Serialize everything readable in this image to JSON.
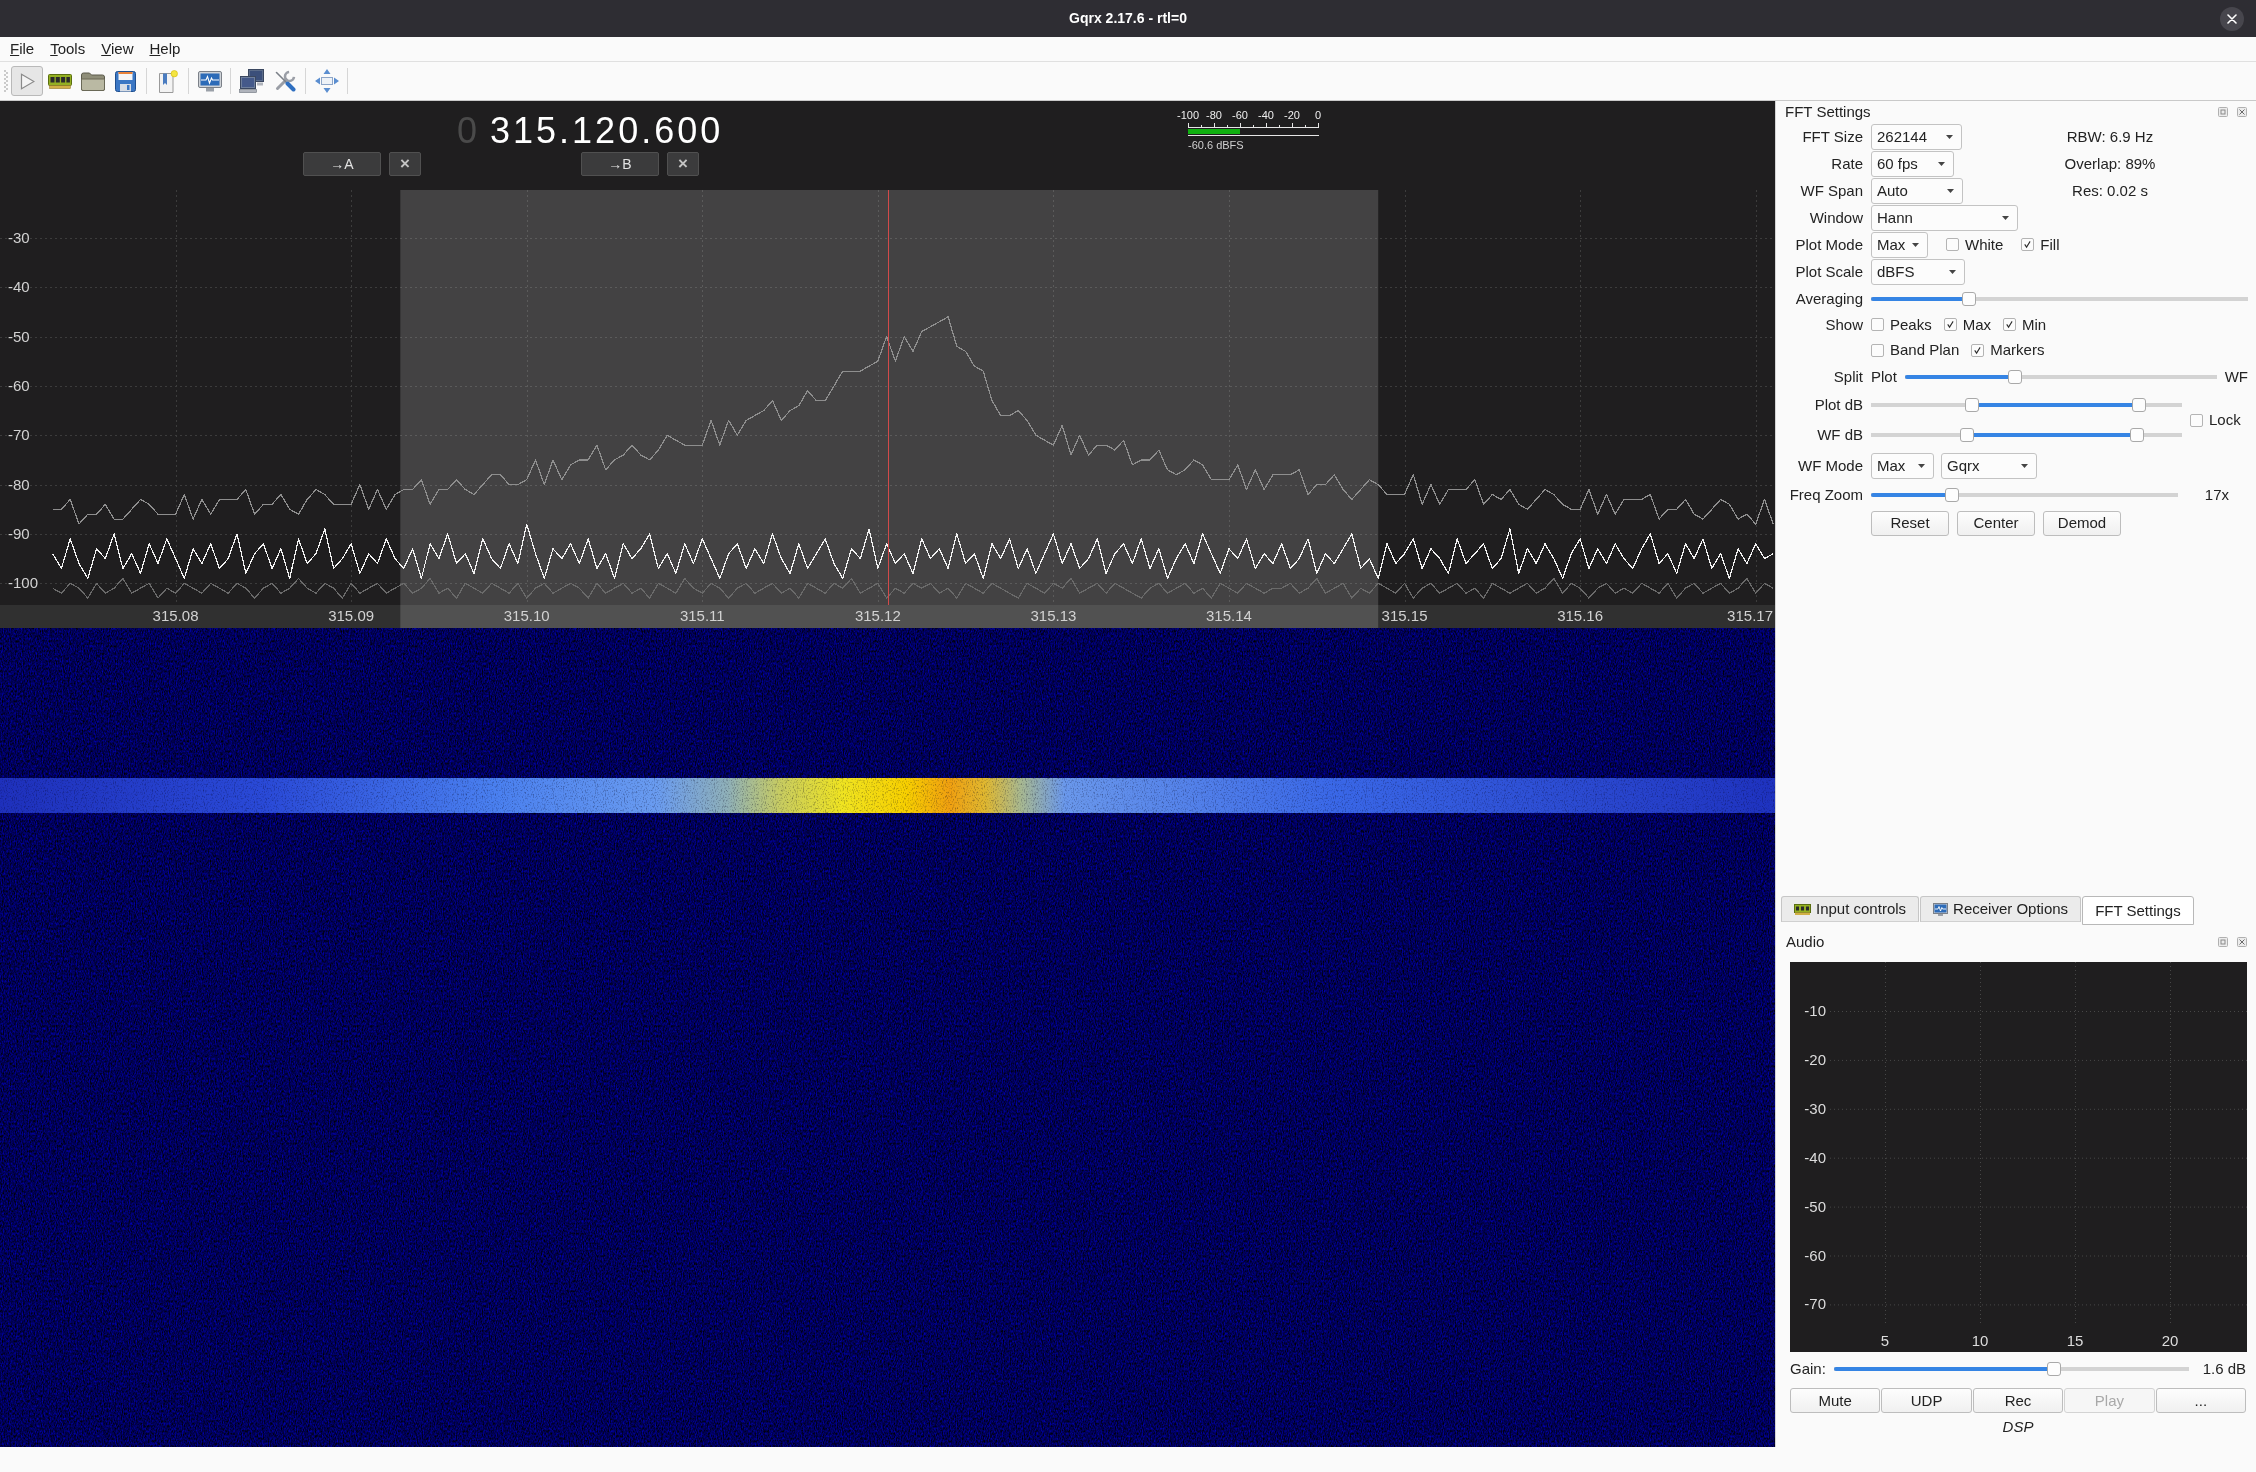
{
  "window": {
    "title": "Gqrx 2.17.6 - rtl=0"
  },
  "menu": [
    "File",
    "Tools",
    "View",
    "Help"
  ],
  "toolbar": {
    "start_pressed": true
  },
  "frequency": {
    "inactive_digits": "0",
    "digits": "315.120.600"
  },
  "markers": [
    {
      "set": "→A",
      "clear": "×"
    },
    {
      "set": "→B",
      "clear": "×"
    }
  ],
  "meter": {
    "ticks": [
      "-100",
      "-80",
      "-60",
      "-40",
      "-20",
      "0"
    ],
    "level": 0.394,
    "reading": "-60.6 dBFS"
  },
  "spectrum": {
    "chart_data": {
      "type": "line",
      "xlim": [
        315.07,
        315.1711
      ],
      "ylim": [
        -104.4,
        -20.3
      ],
      "grid": true,
      "xticks": [
        {
          "value": 315.08,
          "label": "315.08"
        },
        {
          "value": 315.09,
          "label": "315.09"
        },
        {
          "value": 315.1,
          "label": "315.10"
        },
        {
          "value": 315.11,
          "label": "315.11"
        },
        {
          "value": 315.12,
          "label": "315.12"
        },
        {
          "value": 315.13,
          "label": "315.13"
        },
        {
          "value": 315.14,
          "label": "315.14"
        },
        {
          "value": 315.15,
          "label": "315.15"
        },
        {
          "value": 315.16,
          "label": "315.16"
        },
        {
          "value": 315.17,
          "label": "315.17"
        }
      ],
      "yticks": [
        -30,
        -40,
        -50,
        -60,
        -70,
        -80,
        -90,
        -100
      ],
      "bands": [
        {
          "axis": "x",
          "from": 315.0928,
          "to": 315.1485
        }
      ],
      "ref_lines": [
        {
          "axis": "x",
          "value": 315.1206,
          "color": "#d24a4a"
        }
      ],
      "x": [
        315.073,
        315.0735,
        315.074,
        315.0745,
        315.075,
        315.0755,
        315.076,
        315.0765,
        315.077,
        315.0775,
        315.078,
        315.0785,
        315.079,
        315.0795,
        315.08,
        315.0805,
        315.081,
        315.0815,
        315.082,
        315.0825,
        315.083,
        315.0835,
        315.084,
        315.0845,
        315.085,
        315.0855,
        315.086,
        315.0865,
        315.087,
        315.0875,
        315.088,
        315.0885,
        315.089,
        315.0895,
        315.09,
        315.0905,
        315.091,
        315.0915,
        315.092,
        315.0925,
        315.093,
        315.0935,
        315.094,
        315.0945,
        315.095,
        315.0955,
        315.096,
        315.0965,
        315.097,
        315.0975,
        315.098,
        315.0985,
        315.099,
        315.0995,
        315.1,
        315.1005,
        315.101,
        315.1015,
        315.102,
        315.1025,
        315.103,
        315.1035,
        315.104,
        315.1045,
        315.105,
        315.1055,
        315.106,
        315.1065,
        315.107,
        315.1075,
        315.108,
        315.1085,
        315.109,
        315.1095,
        315.11,
        315.1105,
        315.111,
        315.1115,
        315.112,
        315.1125,
        315.113,
        315.1135,
        315.114,
        315.1145,
        315.115,
        315.1155,
        315.116,
        315.1165,
        315.117,
        315.1175,
        315.118,
        315.1185,
        315.119,
        315.1195,
        315.12,
        315.1205,
        315.121,
        315.1215,
        315.122,
        315.1225,
        315.123,
        315.1235,
        315.124,
        315.1245,
        315.125,
        315.1255,
        315.126,
        315.1265,
        315.127,
        315.1275,
        315.128,
        315.1285,
        315.129,
        315.1295,
        315.13,
        315.1305,
        315.131,
        315.1315,
        315.132,
        315.1325,
        315.133,
        315.1335,
        315.134,
        315.1345,
        315.135,
        315.1355,
        315.136,
        315.1365,
        315.137,
        315.1375,
        315.138,
        315.1385,
        315.139,
        315.1395,
        315.14,
        315.1405,
        315.141,
        315.1415,
        315.142,
        315.1425,
        315.143,
        315.1435,
        315.144,
        315.1445,
        315.145,
        315.1455,
        315.146,
        315.1465,
        315.147,
        315.1475,
        315.148,
        315.1485,
        315.149,
        315.1495,
        315.15,
        315.1505,
        315.151,
        315.1515,
        315.152,
        315.1525,
        315.153,
        315.1535,
        315.154,
        315.1545,
        315.155,
        315.1555,
        315.156,
        315.1565,
        315.157,
        315.1575,
        315.158,
        315.1585,
        315.159,
        315.1595,
        315.16,
        315.1605,
        315.161,
        315.1615,
        315.162,
        315.1625,
        315.163,
        315.1635,
        315.164,
        315.1645,
        315.165,
        315.1655,
        315.166,
        315.1665,
        315.167,
        315.1675,
        315.168,
        315.1685,
        315.169,
        315.1695,
        315.17,
        315.1705,
        315.171
      ],
      "series": [
        {
          "color": "#8e8e8e",
          "values": [
            -85,
            -85,
            -83,
            -88,
            -86,
            -86,
            -84,
            -87,
            -87,
            -85,
            -83,
            -84,
            -86,
            -86,
            -86,
            -82,
            -87,
            -83,
            -86,
            -83,
            -83,
            -83,
            -81,
            -86,
            -84,
            -84,
            -82,
            -85,
            -86,
            -83,
            -81,
            -82,
            -84,
            -84,
            -84,
            -80,
            -85,
            -81,
            -85,
            -82,
            -81,
            -81,
            -79,
            -84,
            -81,
            -81,
            -79,
            -81,
            -82,
            -80,
            -78,
            -78,
            -80,
            -80,
            -79,
            -75,
            -80,
            -75,
            -79,
            -76,
            -75,
            -75,
            -72,
            -77,
            -75,
            -74,
            -72,
            -74,
            -75,
            -73,
            -70,
            -71,
            -72,
            -72,
            -72,
            -67,
            -72,
            -67,
            -70,
            -67,
            -66,
            -65,
            -63,
            -67,
            -65,
            -64,
            -61,
            -63,
            -63,
            -60,
            -57,
            -57,
            -57,
            -56,
            -55,
            -50,
            -55,
            -50,
            -53,
            -49,
            -48,
            -47,
            -46,
            -52,
            -53,
            -56,
            -57,
            -63,
            -66,
            -66,
            -65,
            -67,
            -70,
            -71,
            -72,
            -68,
            -74,
            -70,
            -74,
            -72,
            -72,
            -73,
            -71,
            -76,
            -75,
            -75,
            -73,
            -77,
            -78,
            -77,
            -75,
            -76,
            -79,
            -79,
            -79,
            -76,
            -81,
            -77,
            -81,
            -78,
            -78,
            -78,
            -77,
            -82,
            -80,
            -80,
            -78,
            -81,
            -83,
            -81,
            -79,
            -80,
            -82,
            -82,
            -82,
            -78,
            -84,
            -80,
            -84,
            -81,
            -81,
            -81,
            -79,
            -84,
            -82,
            -83,
            -81,
            -84,
            -85,
            -83,
            -81,
            -82,
            -84,
            -85,
            -85,
            -81,
            -86,
            -82,
            -86,
            -83,
            -83,
            -83,
            -82,
            -87,
            -85,
            -85,
            -83,
            -86,
            -87,
            -85,
            -83,
            -84,
            -87,
            -86,
            -88,
            -83,
            -88
          ]
        },
        {
          "color": "#6a6a6a",
          "values": [
            -101,
            -102,
            -100,
            -101,
            -103,
            -100,
            -102,
            -101,
            -99,
            -102,
            -101,
            -100,
            -103,
            -101,
            -102,
            -100,
            -101,
            -102,
            -100,
            -101,
            -102,
            -100,
            -101,
            -103,
            -101,
            -100,
            -102,
            -101,
            -99,
            -101,
            -102,
            -100,
            -101,
            -103,
            -100,
            -102,
            -101,
            -100,
            -102,
            -101,
            -100,
            -102,
            -101,
            -99,
            -102,
            -101,
            -103,
            -100,
            -101,
            -102,
            -100,
            -101,
            -102,
            -100,
            -103,
            -101,
            -100,
            -102,
            -101,
            -100,
            -101,
            -103,
            -100,
            -102,
            -101,
            -100,
            -102,
            -101,
            -103,
            -100,
            -101,
            -102,
            -99,
            -101,
            -102,
            -100,
            -101,
            -103,
            -101,
            -100,
            -102,
            -101,
            -100,
            -102,
            -101,
            -103,
            -100,
            -101,
            -102,
            -100,
            -101,
            -99,
            -102,
            -101,
            -100,
            -103,
            -101,
            -102,
            -100,
            -101,
            -100,
            -102,
            -101,
            -103,
            -100,
            -101,
            -102,
            -100,
            -101,
            -102,
            -103,
            -100,
            -101,
            -102,
            -100,
            -101,
            -99,
            -102,
            -101,
            -100,
            -102,
            -100,
            -101,
            -102,
            -103,
            -101,
            -100,
            -102,
            -101,
            -100,
            -102,
            -101,
            -103,
            -100,
            -101,
            -102,
            -100,
            -101,
            -102,
            -101,
            -101,
            -100,
            -102,
            -101,
            -99,
            -102,
            -101,
            -100,
            -103,
            -101,
            -102,
            -100,
            -101,
            -102,
            -100,
            -103,
            -101,
            -100,
            -102,
            -101,
            -100,
            -102,
            -101,
            -103,
            -100,
            -101,
            -102,
            -101,
            -100,
            -102,
            -101,
            -99,
            -102,
            -100,
            -101,
            -103,
            -101,
            -100,
            -102,
            -101,
            -102,
            -100,
            -101,
            -102,
            -100,
            -103,
            -101,
            -100,
            -102,
            -101,
            -100,
            -102,
            -101,
            -99,
            -102,
            -100,
            -101
          ]
        },
        {
          "color": "#f2f2f2",
          "values": [
            -94,
            -97,
            -91,
            -96,
            -99,
            -93,
            -95,
            -90,
            -97,
            -94,
            -98,
            -92,
            -96,
            -91,
            -95,
            -99,
            -93,
            -96,
            -92,
            -97,
            -95,
            -90,
            -98,
            -94,
            -92,
            -97,
            -93,
            -99,
            -91,
            -96,
            -94,
            -89,
            -97,
            -95,
            -92,
            -98,
            -94,
            -96,
            -91,
            -95,
            -97,
            -93,
            -99,
            -92,
            -95,
            -90,
            -96,
            -94,
            -98,
            -91,
            -95,
            -97,
            -92,
            -96,
            -88,
            -94,
            -99,
            -93,
            -95,
            -92,
            -96,
            -91,
            -97,
            -94,
            -99,
            -92,
            -95,
            -93,
            -90,
            -97,
            -94,
            -98,
            -92,
            -96,
            -91,
            -95,
            -99,
            -94,
            -92,
            -97,
            -93,
            -96,
            -90,
            -95,
            -98,
            -92,
            -97,
            -94,
            -91,
            -96,
            -99,
            -93,
            -95,
            -89,
            -97,
            -92,
            -96,
            -94,
            -98,
            -91,
            -95,
            -93,
            -97,
            -90,
            -96,
            -94,
            -99,
            -92,
            -95,
            -91,
            -97,
            -93,
            -98,
            -94,
            -90,
            -96,
            -92,
            -97,
            -95,
            -91,
            -98,
            -94,
            -92,
            -96,
            -91,
            -97,
            -93,
            -99,
            -95,
            -92,
            -96,
            -90,
            -94,
            -98,
            -93,
            -95,
            -91,
            -97,
            -94,
            -96,
            -92,
            -97,
            -95,
            -91,
            -98,
            -94,
            -96,
            -93,
            -90,
            -97,
            -95,
            -99,
            -92,
            -96,
            -94,
            -91,
            -97,
            -93,
            -95,
            -98,
            -91,
            -96,
            -94,
            -92,
            -97,
            -95,
            -89,
            -98,
            -93,
            -96,
            -92,
            -95,
            -99,
            -94,
            -91,
            -97,
            -93,
            -96,
            -92,
            -95,
            -97,
            -93,
            -90,
            -96,
            -94,
            -98,
            -92,
            -95,
            -91,
            -97,
            -94,
            -99,
            -93,
            -96,
            -92,
            -95,
            -94
          ]
        }
      ]
    }
  },
  "fft_settings": {
    "title": "FFT Settings",
    "rows": [
      {
        "kind": "combo",
        "label": "FFT Size",
        "value": "262144",
        "info": "RBW: 6.9 Hz"
      },
      {
        "kind": "combo",
        "label": "Rate",
        "value": "60 fps",
        "info": "Overlap: 89%"
      },
      {
        "kind": "combo",
        "label": "WF Span",
        "value": "Auto",
        "info": "Res: 0.02 s"
      },
      {
        "kind": "combo",
        "label": "Window",
        "value": "Hann"
      },
      {
        "kind": "combo",
        "label": "Plot Mode",
        "value": "Max",
        "checks": [
          {
            "label": "White",
            "checked": false
          },
          {
            "label": "Fill",
            "checked": true
          }
        ]
      },
      {
        "kind": "combo",
        "label": "Plot Scale",
        "value": "dBFS"
      },
      {
        "kind": "slider",
        "label": "Averaging",
        "level": 0.25
      },
      {
        "kind": "checks",
        "label": "Show",
        "checks": [
          {
            "label": "Peaks",
            "checked": false
          },
          {
            "label": "Max",
            "checked": true
          },
          {
            "label": "Min",
            "checked": true
          }
        ]
      },
      {
        "kind": "checks",
        "checks": [
          {
            "label": "Band Plan",
            "checked": false
          },
          {
            "label": "Markers",
            "checked": true
          }
        ]
      },
      {
        "kind": "split",
        "label": "Split",
        "left": "Plot",
        "right": "WF",
        "level": 0.347
      },
      {
        "kind": "range_group",
        "rows": [
          {
            "label": "Plot dB",
            "thumbs": [
              {
                "level": 0.317
              },
              {
                "level": 0.879
              }
            ]
          },
          {
            "label": "WF dB",
            "thumbs": [
              {
                "level": 0.3
              },
              {
                "level": 0.871
              }
            ]
          }
        ],
        "lock": {
          "label": "Lock",
          "checked": false
        }
      },
      {
        "kind": "combos",
        "label": "WF Mode",
        "values": [
          "Max",
          "Gqrx"
        ]
      },
      {
        "kind": "slider",
        "label": "Freq Zoom",
        "level": 0.251,
        "reading": "17x"
      },
      {
        "kind": "buttons",
        "buttons": [
          "Reset",
          "Center",
          "Demod"
        ]
      }
    ]
  },
  "dock_tabs": [
    {
      "label": "Input controls",
      "selected": false
    },
    {
      "label": "Receiver Options",
      "selected": false
    },
    {
      "label": "FFT Settings",
      "selected": true
    }
  ],
  "audio": {
    "title": "Audio",
    "plot": {
      "y_labels": [
        "-10",
        "-20",
        "-30",
        "-40",
        "-50",
        "-60",
        "-70"
      ],
      "x_labels": [
        "5",
        "10",
        "15",
        "20"
      ]
    },
    "gain": {
      "label": "Gain:",
      "level": 0.626,
      "reading": "1.6 dB"
    },
    "buttons": [
      {
        "label": "Mute",
        "disabled": false
      },
      {
        "label": "UDP",
        "disabled": false
      },
      {
        "label": "Rec",
        "disabled": false
      },
      {
        "label": "Play",
        "disabled": true
      },
      {
        "label": "...",
        "disabled": false
      }
    ],
    "footer": "DSP"
  }
}
